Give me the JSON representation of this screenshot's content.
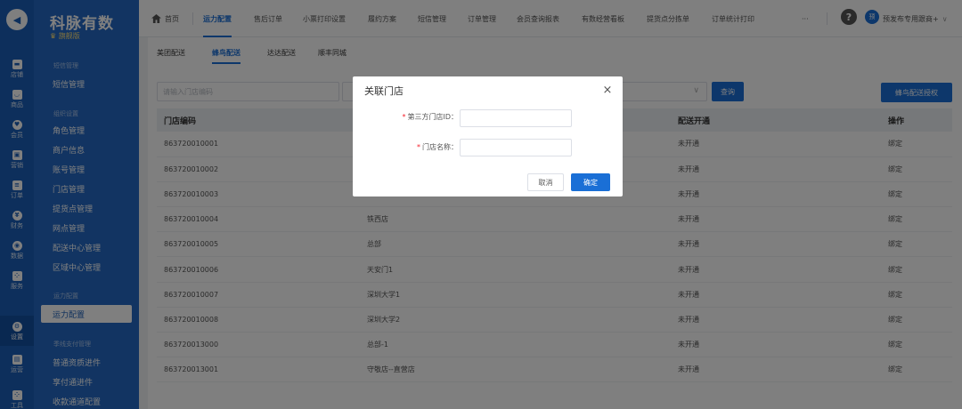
{
  "rail": {
    "items": [
      {
        "label": "店铺",
        "icon": "store-icon"
      },
      {
        "label": "商品",
        "icon": "goods-icon"
      },
      {
        "label": "会员",
        "icon": "member-icon"
      },
      {
        "label": "营销",
        "icon": "marketing-icon"
      },
      {
        "label": "订单",
        "icon": "order-icon"
      },
      {
        "label": "财务",
        "icon": "finance-icon"
      },
      {
        "label": "数据",
        "icon": "data-icon"
      },
      {
        "label": "服务",
        "icon": "service-icon"
      },
      {
        "label": "设置",
        "icon": "settings-icon"
      },
      {
        "label": "运营",
        "icon": "operation-icon"
      },
      {
        "label": "工具",
        "icon": "tools-icon"
      }
    ]
  },
  "sidebar": {
    "brand": "科脉有数",
    "edition": "旗舰版",
    "groups": [
      "短信管理",
      "组织设置",
      "运力配置",
      "季线支付管理"
    ],
    "items": [
      "短信管理",
      "角色管理",
      "商户信息",
      "账号管理",
      "门店管理",
      "提货点管理",
      "网点管理",
      "配送中心管理",
      "区域中心管理",
      "运力配置",
      "普通资质进件",
      "享付通进件",
      "收款通道配置"
    ]
  },
  "topnav": {
    "tabs": [
      "首页",
      "运力配置",
      "售后订单",
      "小票打印设置",
      "履约方案",
      "短信管理",
      "订单管理",
      "会员查询报表",
      "有数经营看板",
      "提货点分拣单",
      "订单统计打印"
    ],
    "more": "···",
    "help": "?",
    "avatar": "预",
    "user": "预发布专用跟商+"
  },
  "subtabs": [
    "美团配送",
    "蜂鸟配送",
    "达达配送",
    "顺丰同城"
  ],
  "filters": {
    "store_code_placeholder": "请输入门店编码",
    "query": "查询",
    "authorize": "蜂鸟配送授权"
  },
  "table": {
    "headers": [
      "门店编码",
      "",
      "配送开通",
      "操作"
    ],
    "rows": [
      {
        "code": "863720010001",
        "name": "",
        "status": "未开通",
        "action": "绑定"
      },
      {
        "code": "863720010002",
        "name": "",
        "status": "未开通",
        "action": "绑定"
      },
      {
        "code": "863720010003",
        "name": "",
        "status": "未开通",
        "action": "绑定"
      },
      {
        "code": "863720010004",
        "name": "铁西店",
        "status": "未开通",
        "action": "绑定"
      },
      {
        "code": "863720010005",
        "name": "总部",
        "status": "未开通",
        "action": "绑定"
      },
      {
        "code": "863720010006",
        "name": "天安门1",
        "status": "未开通",
        "action": "绑定"
      },
      {
        "code": "863720010007",
        "name": "深圳大学1",
        "status": "未开通",
        "action": "绑定"
      },
      {
        "code": "863720010008",
        "name": "深圳大学2",
        "status": "未开通",
        "action": "绑定"
      },
      {
        "code": "863720013000",
        "name": "总部-1",
        "status": "未开通",
        "action": "绑定"
      },
      {
        "code": "863720013001",
        "name": "守敬店--直营店",
        "status": "未开通",
        "action": "绑定"
      }
    ]
  },
  "dialog": {
    "title": "关联门店",
    "close": "×",
    "third_party_id_label": "第三方门店ID：",
    "store_name_label": "门店名称：",
    "required_mark": "*",
    "third_party_id_value": "",
    "store_name_value": "",
    "cancel": "取消",
    "confirm": "确定"
  },
  "colors": {
    "primary": "#1a6fd6",
    "sidebar": "#2468c4",
    "rail": "#1a5fb8",
    "required": "#f5222d"
  }
}
